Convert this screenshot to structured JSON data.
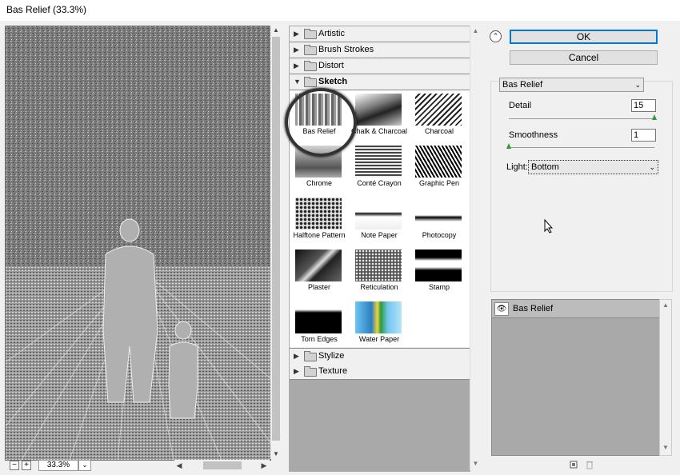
{
  "window": {
    "title": "Bas Relief (33.3%)"
  },
  "preview": {
    "zoom": "33.3%"
  },
  "gallery": {
    "categories_top": [
      {
        "label": "Artistic",
        "expanded": false
      },
      {
        "label": "Brush Strokes",
        "expanded": false
      },
      {
        "label": "Distort",
        "expanded": false
      },
      {
        "label": "Sketch",
        "expanded": true
      }
    ],
    "filters": [
      {
        "label": "Bas Relief",
        "selected": true
      },
      {
        "label": "Chalk & Charcoal"
      },
      {
        "label": "Charcoal"
      },
      {
        "label": "Chrome"
      },
      {
        "label": "Conté Crayon"
      },
      {
        "label": "Graphic Pen"
      },
      {
        "label": "Halftone Pattern"
      },
      {
        "label": "Note Paper"
      },
      {
        "label": "Photocopy"
      },
      {
        "label": "Plaster"
      },
      {
        "label": "Reticulation"
      },
      {
        "label": "Stamp"
      },
      {
        "label": "Torn Edges"
      },
      {
        "label": "Water Paper"
      }
    ],
    "categories_bottom": [
      {
        "label": "Stylize",
        "expanded": false
      },
      {
        "label": "Texture",
        "expanded": false
      }
    ]
  },
  "buttons": {
    "ok": "OK",
    "cancel": "Cancel"
  },
  "options": {
    "filter_select": "Bas Relief",
    "detail_label": "Detail",
    "detail_value": "15",
    "detail_max": 15,
    "smoothness_label": "Smoothness",
    "smoothness_value": "1",
    "smoothness_max": 15,
    "light_label": "Light:",
    "light_value": "Bottom"
  },
  "layers": {
    "items": [
      {
        "label": "Bas Relief"
      }
    ]
  },
  "icons": {
    "collapse": "double-chevron-up-icon",
    "eye": "eye-icon",
    "new_layer": "new-effect-layer-icon",
    "delete": "trash-icon"
  }
}
